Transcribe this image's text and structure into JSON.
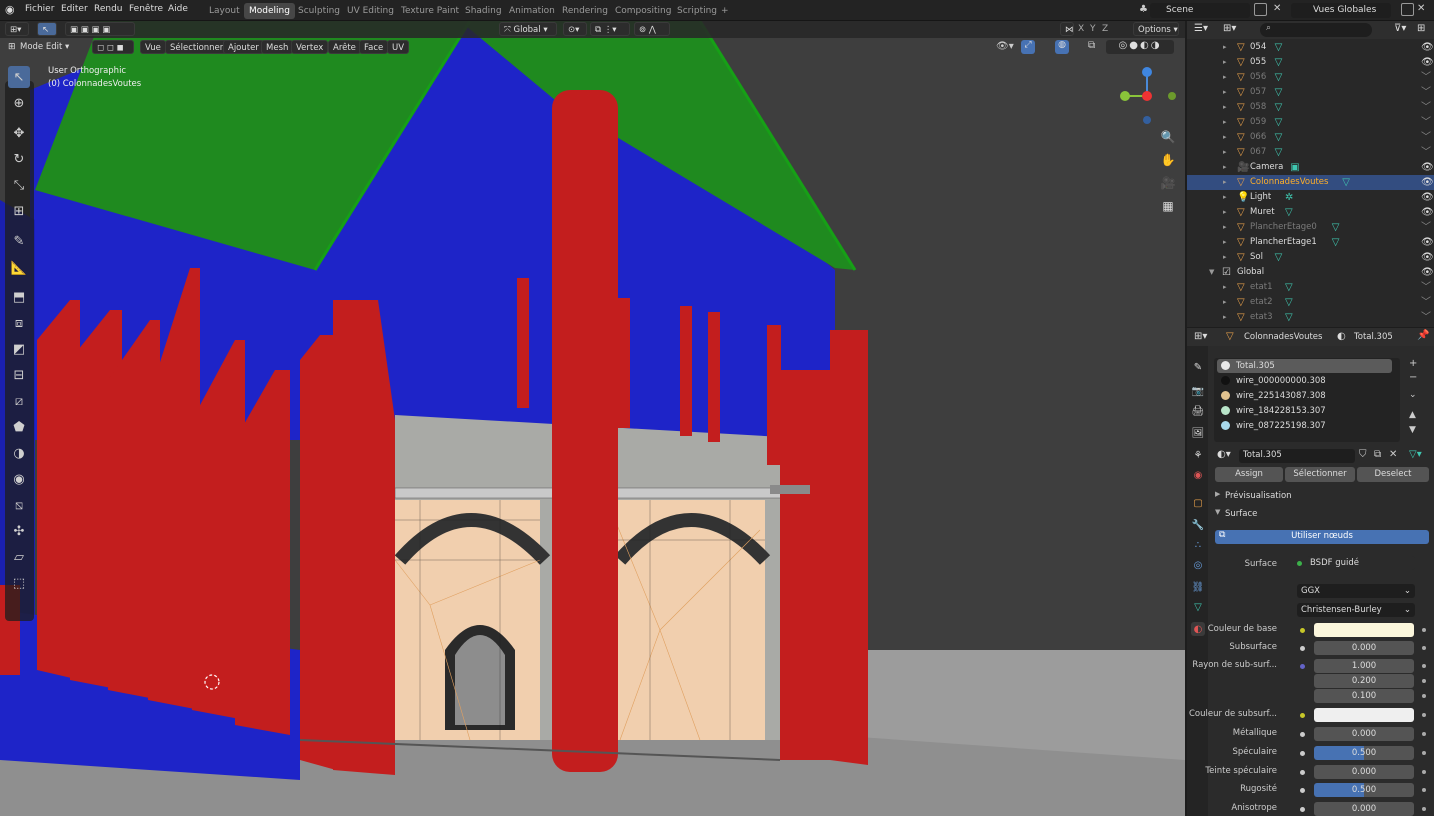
{
  "menu": [
    "Fichier",
    "Editer",
    "Rendu",
    "Fenêtre",
    "Aide"
  ],
  "workspaces": [
    "Layout",
    "Modeling",
    "Sculpting",
    "UV Editing",
    "Texture Paint",
    "Shading",
    "Animation",
    "Rendering",
    "Compositing",
    "Scripting",
    "+"
  ],
  "active_workspace": "Modeling",
  "scene": "Scene",
  "view_layer": "Vues Globales",
  "viewport": {
    "mode": "Mode Edit",
    "menus": [
      "Vue",
      "Sélectionner",
      "Ajouter",
      "Mesh",
      "Vertex",
      "Arête",
      "Face",
      "UV"
    ],
    "transform_orientation": "Global",
    "xyz": [
      "X",
      "Y",
      "Z"
    ],
    "options_label": "Options",
    "view_name": "User Orthographic",
    "object_info": "(0) ColonnadesVoutes"
  },
  "outliner": {
    "search_placeholder": "",
    "rows": [
      {
        "name": "054",
        "dim": false,
        "icon": "mesh-object-icon",
        "visible": true
      },
      {
        "name": "055",
        "dim": false,
        "icon": "mesh-object-icon",
        "visible": true
      },
      {
        "name": "056",
        "dim": true,
        "icon": "mesh-object-icon",
        "visible": false
      },
      {
        "name": "057",
        "dim": true,
        "icon": "mesh-object-icon",
        "visible": false
      },
      {
        "name": "058",
        "dim": true,
        "icon": "mesh-object-icon",
        "visible": false
      },
      {
        "name": "059",
        "dim": true,
        "icon": "mesh-object-icon",
        "visible": false
      },
      {
        "name": "066",
        "dim": true,
        "icon": "mesh-object-icon",
        "visible": false
      },
      {
        "name": "067",
        "dim": true,
        "icon": "mesh-object-icon",
        "visible": false
      },
      {
        "name": "Camera",
        "dim": false,
        "icon": "camera-object-icon",
        "visible": true
      },
      {
        "name": "ColonnadesVoutes",
        "dim": false,
        "icon": "mesh-object-icon",
        "visible": true,
        "selected": true
      },
      {
        "name": "Light",
        "dim": false,
        "icon": "light-object-icon",
        "visible": true
      },
      {
        "name": "Muret",
        "dim": false,
        "icon": "mesh-object-icon",
        "visible": true
      },
      {
        "name": "PlancherEtage0",
        "dim": true,
        "icon": "mesh-object-icon",
        "visible": false
      },
      {
        "name": "PlancherEtage1",
        "dim": false,
        "icon": "mesh-object-icon",
        "visible": true
      },
      {
        "name": "Sol",
        "dim": false,
        "icon": "mesh-object-icon",
        "visible": true
      },
      {
        "name": "Global",
        "dim": false,
        "icon": "collection-icon",
        "visible": true,
        "collection": true
      },
      {
        "name": "etat1",
        "dim": true,
        "icon": "mesh-object-icon",
        "visible": false
      },
      {
        "name": "etat2",
        "dim": true,
        "icon": "mesh-object-icon",
        "visible": false
      },
      {
        "name": "etat3",
        "dim": true,
        "icon": "mesh-object-icon",
        "visible": false
      }
    ]
  },
  "properties": {
    "object_name": "ColonnadesVoutes",
    "material_name": "Total.305",
    "material_slots": [
      {
        "name": "Total.305",
        "color": "#e8e8e8",
        "selected": true
      },
      {
        "name": "wire_000000000.308",
        "color": "#111111"
      },
      {
        "name": "wire_225143087.308",
        "color": "#e1c28f"
      },
      {
        "name": "wire_184228153.307",
        "color": "#b8e4c9"
      },
      {
        "name": "wire_087225198.307",
        "color": "#a8d9ec"
      }
    ],
    "buttons": {
      "assign": "Assign",
      "select": "Sélectionner",
      "deselect": "Deselect"
    },
    "panels": {
      "preview": "Prévisualisation",
      "surface": "Surface"
    },
    "use_nodes": "Utiliser nœuds",
    "surface_label": "Surface",
    "surface_value": "BSDF guidé",
    "distribution": "GGX",
    "subsurface_method": "Christensen-Burley",
    "fields": [
      {
        "label": "Couleur de base",
        "type": "color",
        "color": "#fbf6dc"
      },
      {
        "label": "Subsurface",
        "value": "0.000"
      },
      {
        "label": "Rayon de sub-surf...",
        "value": "1.000"
      },
      {
        "label": "",
        "value": "0.200"
      },
      {
        "label": "",
        "value": "0.100"
      },
      {
        "label": "Couleur de subsurf...",
        "type": "color",
        "color": "#efefef"
      },
      {
        "label": "Métallique",
        "value": "0.000"
      },
      {
        "label": "Spéculaire",
        "value": "0.500",
        "fraction": 0.5
      },
      {
        "label": "Teinte spéculaire",
        "value": "0.000"
      },
      {
        "label": "Rugosité",
        "value": "0.500",
        "fraction": 0.5
      },
      {
        "label": "Anisotrope",
        "value": "0.000"
      }
    ]
  },
  "colors": {
    "roof": "#1f8a1f",
    "wall": "#1e24c8",
    "column": "#c31e1e",
    "selected_row": "#334d80",
    "accent": "#4772b3"
  }
}
